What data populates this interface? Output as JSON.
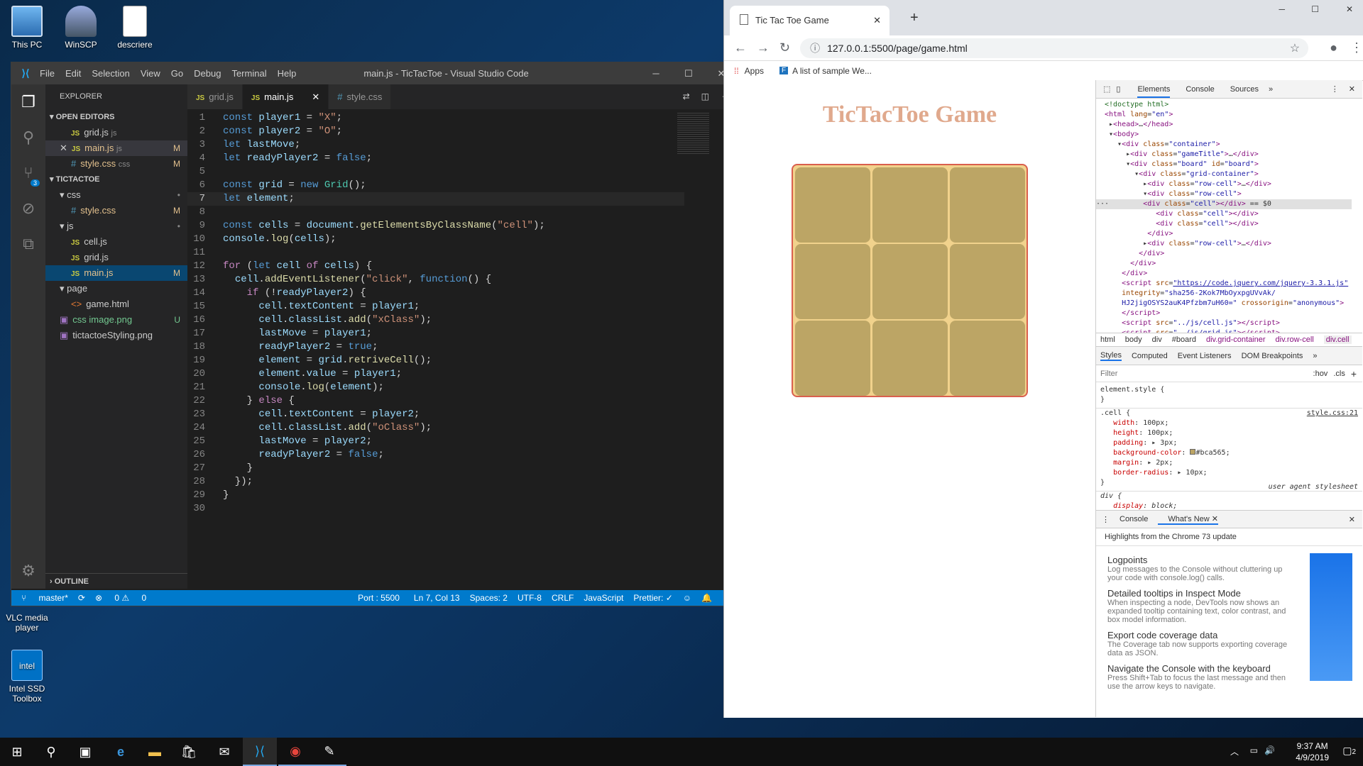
{
  "desktop": {
    "icons": [
      {
        "label": "This PC"
      },
      {
        "label": "WinSCP"
      },
      {
        "label": "descriere"
      },
      {
        "label": "VLC media player"
      },
      {
        "label": "Intel SSD Toolbox"
      }
    ]
  },
  "vscode": {
    "menu": [
      "File",
      "Edit",
      "Selection",
      "View",
      "Go",
      "Debug",
      "Terminal",
      "Help"
    ],
    "title": "main.js - TicTacToe - Visual Studio Code",
    "explorer_title": "EXPLORER",
    "open_editors_title": "OPEN EDITORS",
    "open_editors": [
      {
        "name": "grid.js",
        "desc": "js",
        "badge": ""
      },
      {
        "name": "main.js",
        "desc": "js",
        "badge": "M"
      },
      {
        "name": "style.css",
        "desc": "css",
        "badge": "M"
      }
    ],
    "project_title": "TICTACTOE",
    "tree": [
      {
        "name": "css",
        "badge": "•"
      },
      {
        "name": "style.css",
        "badge": "M"
      },
      {
        "name": "js",
        "badge": "•"
      },
      {
        "name": "cell.js",
        "badge": ""
      },
      {
        "name": "grid.js",
        "badge": ""
      },
      {
        "name": "main.js",
        "badge": "M"
      },
      {
        "name": "page",
        "badge": ""
      },
      {
        "name": "game.html",
        "badge": ""
      },
      {
        "name": "css image.png",
        "badge": "U"
      },
      {
        "name": "tictactoeStyling.png",
        "badge": ""
      }
    ],
    "outline_title": "OUTLINE",
    "scm_badge": "3",
    "tabs": [
      "grid.js",
      "main.js",
      "style.css"
    ],
    "code_lines": [
      "const player1 = \"X\";",
      "const player2 = \"O\";",
      "let lastMove;",
      "let readyPlayer2 = false;",
      "",
      "const grid = new Grid();",
      "let element;",
      "",
      "const cells = document.getElementsByClassName(\"cell\");",
      "console.log(cells);",
      "",
      "for (let cell of cells) {",
      "  cell.addEventListener(\"click\", function() {",
      "    if (!readyPlayer2) {",
      "      cell.textContent = player1;",
      "      cell.classList.add(\"xClass\");",
      "      lastMove = player1;",
      "      readyPlayer2 = true;",
      "      element = grid.retriveCell();",
      "      element.value = player1;",
      "      console.log(element);",
      "    } else {",
      "      cell.textContent = player2;",
      "      cell.classList.add(\"oClass\");",
      "      lastMove = player2;",
      "      readyPlayer2 = false;",
      "    }",
      "  });",
      "}",
      ""
    ],
    "status": {
      "branch": "master*",
      "errors": "0",
      "warnings": "0",
      "port": "Port : 5500",
      "position": "Ln 7, Col 13",
      "spaces": "Spaces: 2",
      "encoding": "UTF-8",
      "eol": "CRLF",
      "language": "JavaScript",
      "prettier": "Prettier: ✓",
      "notifications": "1"
    }
  },
  "chrome": {
    "tab_title": "Tic Tac Toe Game",
    "url": "127.0.0.1:5500/page/game.html",
    "bookmarks": [
      "Apps",
      "A list of sample We..."
    ],
    "page_title": "TicTacToe Game",
    "devtools": {
      "tabs": [
        "Elements",
        "Console",
        "Sources"
      ],
      "breadcrumbs": [
        "html",
        "body",
        "div",
        "#board",
        "div.grid-container",
        "div.row-cell",
        "div.cell"
      ],
      "style_tabs": [
        "Styles",
        "Computed",
        "Event Listeners",
        "DOM Breakpoints"
      ],
      "filter_placeholder": "Filter",
      "hov": ":hov",
      "cls": ".cls",
      "style_rule_link": "style.css:21",
      "ua_label": "user agent stylesheet",
      "drawer_tabs": [
        "Console",
        "What's New"
      ],
      "whats_new_header": "Highlights from the Chrome 73 update",
      "whats_new": [
        {
          "title": "Logpoints",
          "desc": "Log messages to the Console without cluttering up your code with console.log() calls."
        },
        {
          "title": "Detailed tooltips in Inspect Mode",
          "desc": "When inspecting a node, DevTools now shows an expanded tooltip containing text, color contrast, and box model information."
        },
        {
          "title": "Export code coverage data",
          "desc": "The Coverage tab now supports exporting coverage data as JSON."
        },
        {
          "title": "Navigate the Console with the keyboard",
          "desc": "Press Shift+Tab to focus the last message and then use the arrow keys to navigate."
        }
      ]
    }
  },
  "taskbar": {
    "time": "9:37 AM",
    "date": "4/9/2019",
    "notif_count": "2"
  },
  "colors": {
    "cell": "#bca565",
    "board_bg": "#f1d28c",
    "title": "#e0a98d",
    "vs_status": "#007acc"
  }
}
